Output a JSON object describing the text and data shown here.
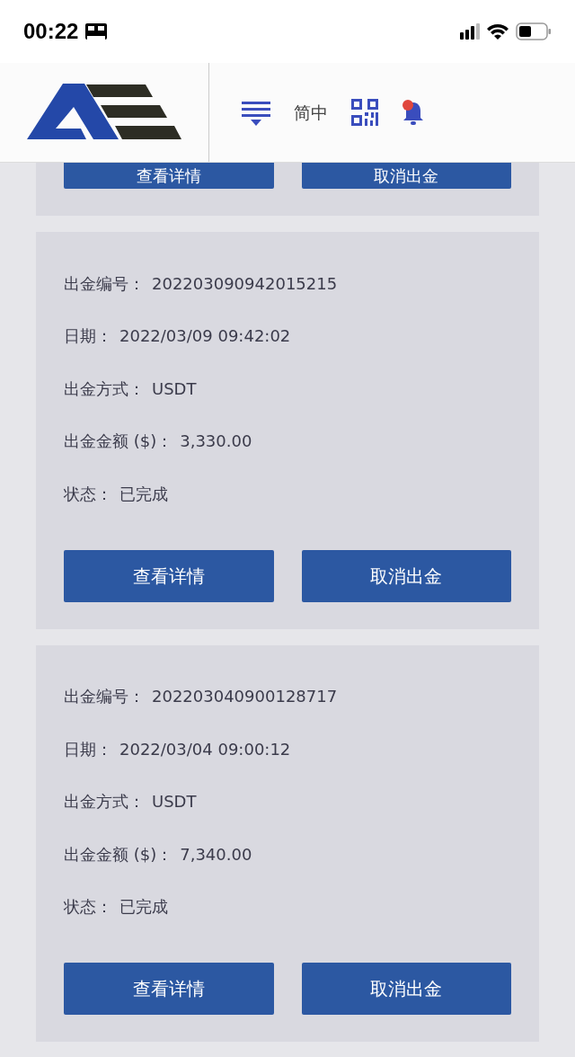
{
  "status_bar": {
    "time": "00:22"
  },
  "header": {
    "language": "简中",
    "notification_dot": true
  },
  "withdrawals": [
    {
      "buttons": [
        "查看详情",
        "取消出金"
      ]
    },
    {
      "fields": [
        {
          "label": "出金编号：",
          "value": "202203090942015215"
        },
        {
          "label": "日期：",
          "value": "2022/03/09 09:42:02"
        },
        {
          "label": "出金方式：",
          "value": "USDT"
        },
        {
          "label": "出金金额 ($)：",
          "value": "3,330.00"
        },
        {
          "label": "状态：",
          "value": "已完成"
        }
      ],
      "buttons": [
        "查看详情",
        "取消出金"
      ]
    },
    {
      "fields": [
        {
          "label": "出金编号：",
          "value": "202203040900128717"
        },
        {
          "label": "日期：",
          "value": "2022/03/04 09:00:12"
        },
        {
          "label": "出金方式：",
          "value": "USDT"
        },
        {
          "label": "出金金额 ($)：",
          "value": "7,340.00"
        },
        {
          "label": "状态：",
          "value": "已完成"
        }
      ],
      "buttons": [
        "查看详情",
        "取消出金"
      ]
    }
  ]
}
